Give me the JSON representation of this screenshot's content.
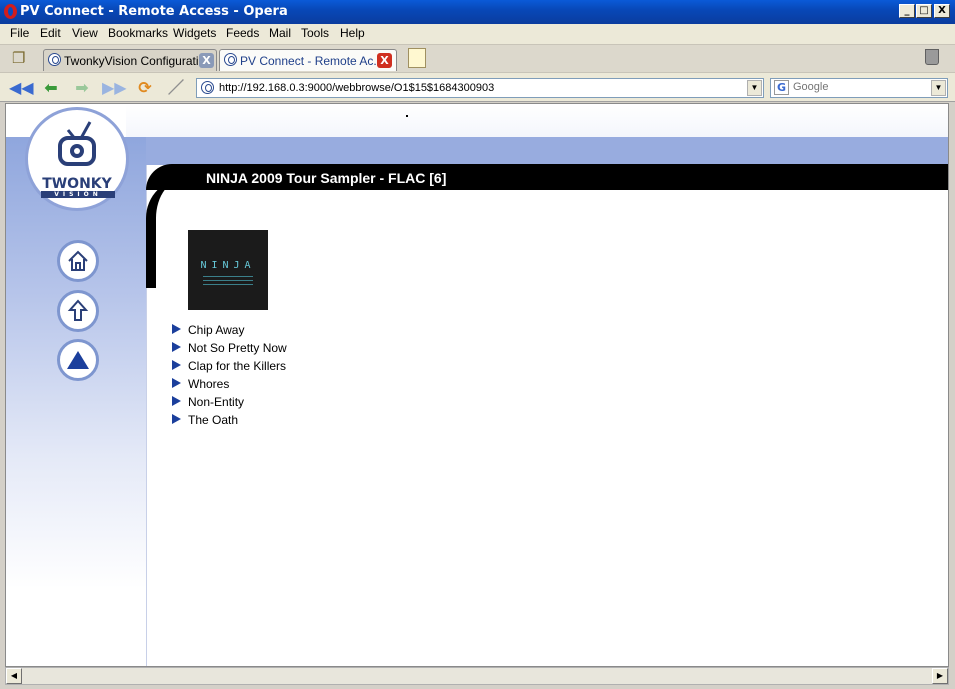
{
  "window": {
    "title": "PV Connect - Remote Access - Opera",
    "controls": [
      "_",
      "□",
      "X"
    ]
  },
  "menu": [
    "File",
    "Edit",
    "View",
    "Bookmarks",
    "Widgets",
    "Feeds",
    "Mail",
    "Tools",
    "Help"
  ],
  "tabs": [
    {
      "label": "TwonkyVision Configuration",
      "active": false
    },
    {
      "label": "PV Connect - Remote Ac...",
      "active": true
    }
  ],
  "address": {
    "url": "http://192.168.0.3:9000/webbrowse/O1$15$1684300903"
  },
  "search": {
    "placeholder": "Google"
  },
  "logo": {
    "brand": "TWONKY",
    "sub": "VISION"
  },
  "album": {
    "title": "NINJA 2009 Tour Sampler - FLAC [6]",
    "art_text": "NINJA"
  },
  "tracks": [
    "Chip Away",
    "Not So Pretty Now",
    "Clap for the Killers",
    "Whores",
    "Non-Entity",
    "The Oath"
  ],
  "colors": {
    "accent": "#1b3f9c",
    "band": "#98acdf",
    "title_bar": "#0a4ac0",
    "close_active": "#d03020"
  },
  "icons": {
    "nav": [
      "home-icon",
      "up-arrow-icon",
      "triangle-up-icon"
    ],
    "toolbar": [
      "rewind-icon",
      "back-icon",
      "forward-icon",
      "fast-forward-icon",
      "reload-icon",
      "edit-icon"
    ]
  }
}
